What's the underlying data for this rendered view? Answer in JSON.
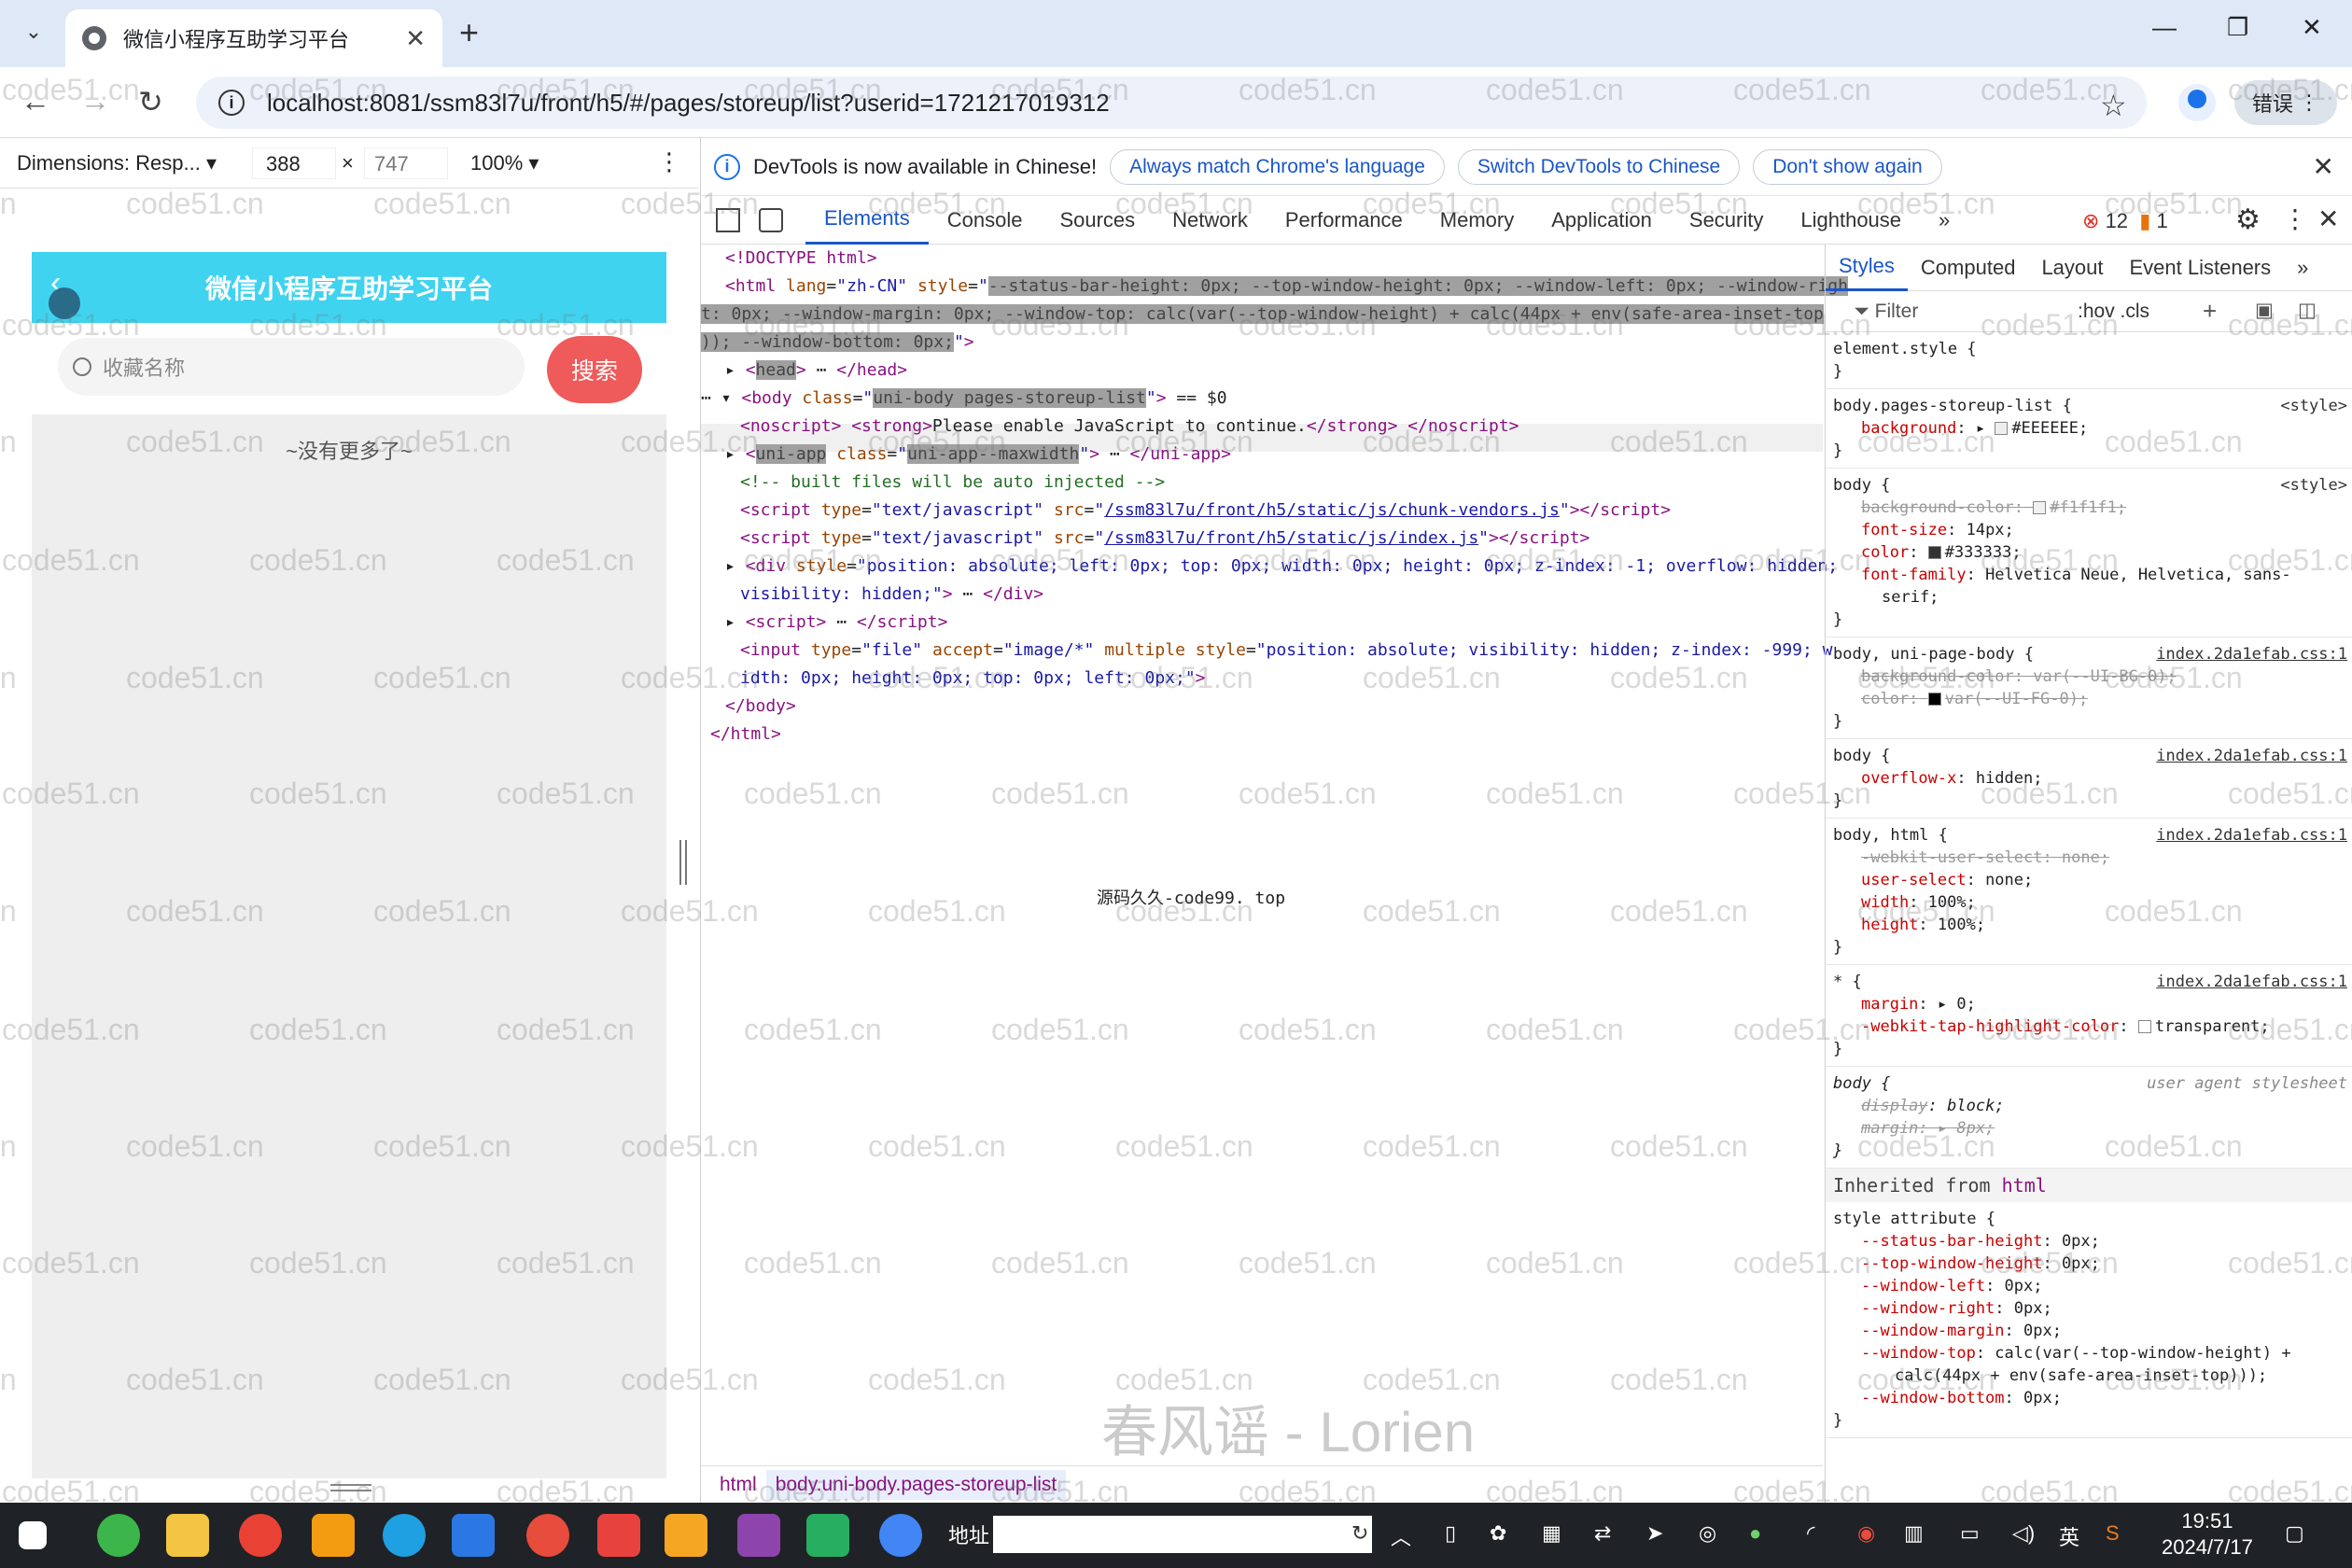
{
  "browser": {
    "tab_title": "微信小程序互助学习平台",
    "url": "localhost:8081/ssm83l7u/front/h5/#/pages/storeup/list?userid=1721217019312",
    "error_button": "错误"
  },
  "device_toolbar": {
    "dimensions_label": "Dimensions: Resp... ▾",
    "width": "388",
    "times": "×",
    "height": "747",
    "zoom": "100% ▾"
  },
  "phone": {
    "nav_title": "微信小程序互助学习平台",
    "search_placeholder": "收藏名称",
    "search_button": "搜索",
    "empty_text": "~没有更多了~"
  },
  "devtools": {
    "infobar": {
      "message": "DevTools is now available in Chinese!",
      "btn1": "Always match Chrome's language",
      "btn2": "Switch DevTools to Chinese",
      "btn3": "Don't show again"
    },
    "tabs": [
      "Elements",
      "Console",
      "Sources",
      "Network",
      "Performance",
      "Memory",
      "Application",
      "Security",
      "Lighthouse"
    ],
    "error_count": "12",
    "warning_count": "1",
    "mirror_text": "源码久久-code99. top",
    "breadcrumbs": [
      "html",
      "body.uni-body.pages-storeup-list"
    ],
    "styles_tabs": [
      "Styles",
      "Computed",
      "Layout",
      "Event Listeners"
    ],
    "filter_placeholder": "Filter",
    "filter_tools": ":hov  .cls",
    "inherited_label": "Inherited from",
    "inherited_tag": "html"
  },
  "watermark": "code51.cn",
  "signature": "春风谣 - Lorien",
  "taskbar": {
    "address_label": "地址",
    "time": "19:51",
    "date": "2024/7/17",
    "ime": "英"
  }
}
